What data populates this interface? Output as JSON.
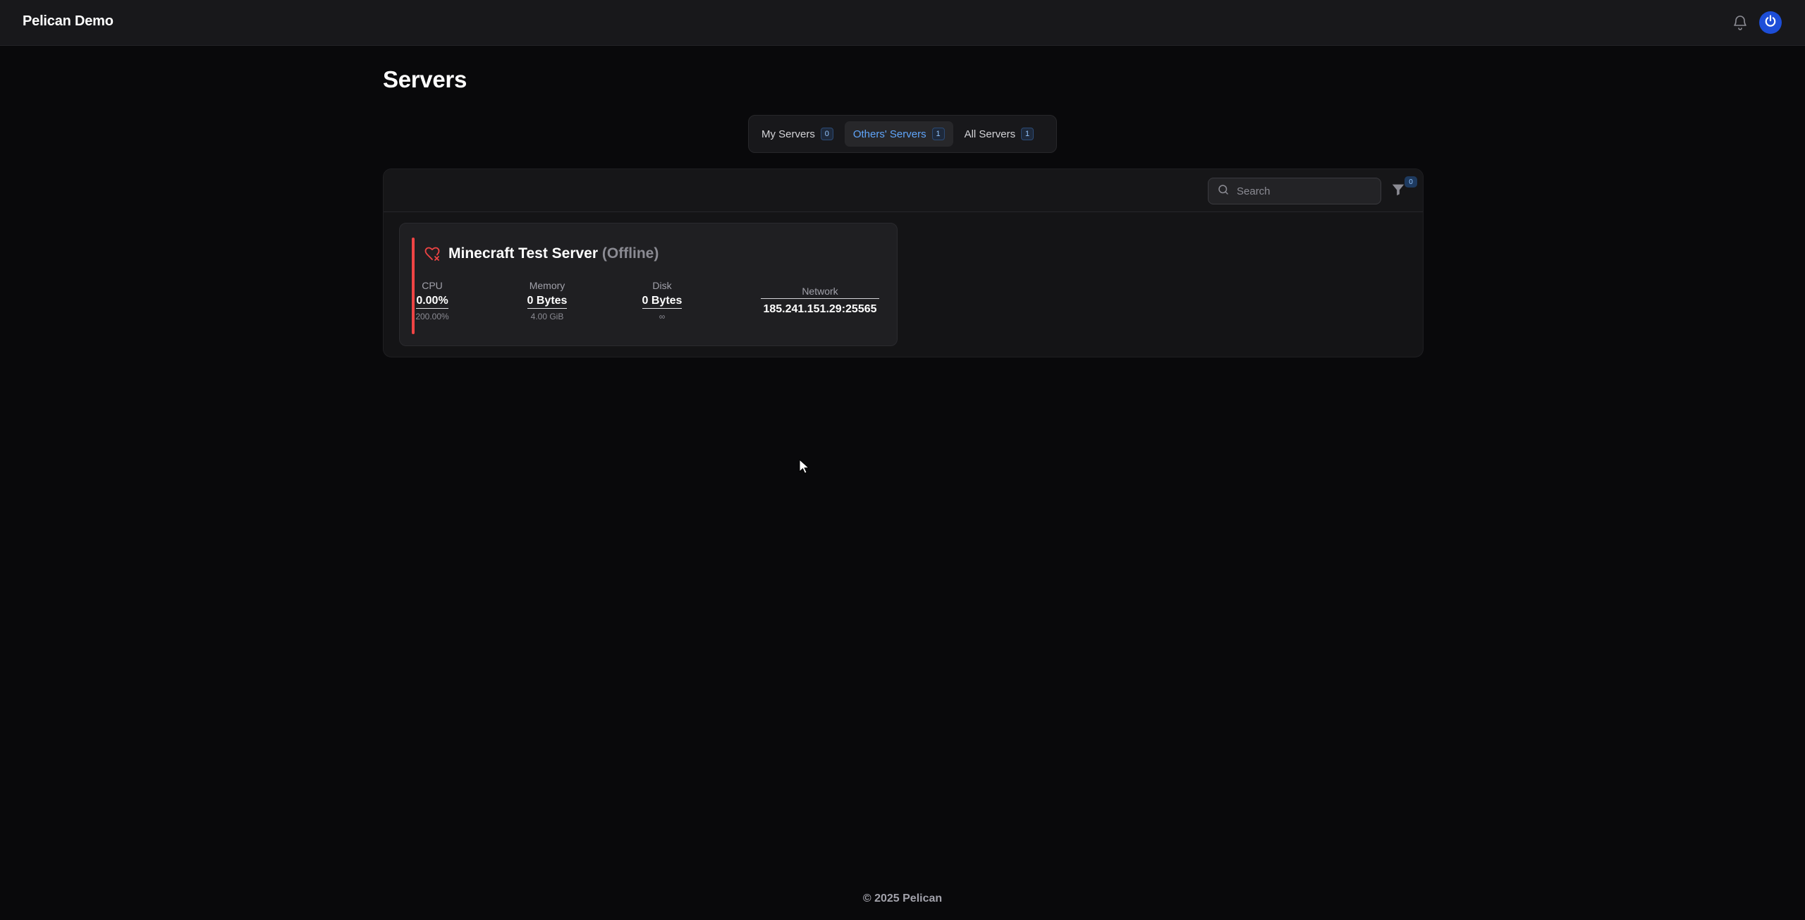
{
  "app": {
    "brand": "Pelican Demo"
  },
  "header": {
    "notifications_icon": "bell-icon",
    "user_icon": "power-icon",
    "accent": "#1d4ed8"
  },
  "page": {
    "title": "Servers"
  },
  "tabs": [
    {
      "label": "My Servers",
      "count": "0",
      "active": false
    },
    {
      "label": "Others' Servers",
      "count": "1",
      "active": true
    },
    {
      "label": "All Servers",
      "count": "1",
      "active": false
    }
  ],
  "toolbar": {
    "search_placeholder": "Search",
    "search_value": "",
    "filter_count": "0"
  },
  "servers": [
    {
      "name": "Minecraft Test Server",
      "status": "(Offline)",
      "status_color": "#ef4444",
      "status_icon": "heart-x-icon",
      "cpu": {
        "label": "CPU",
        "value": "0.00%",
        "limit": "200.00%"
      },
      "memory": {
        "label": "Memory",
        "value": "0 Bytes",
        "limit": "4.00 GiB"
      },
      "disk": {
        "label": "Disk",
        "value": "0 Bytes",
        "limit": "∞"
      },
      "network": {
        "label": "Network",
        "value": "185.241.151.29:25565"
      }
    }
  ],
  "footer": {
    "text": "© 2025 Pelican"
  }
}
